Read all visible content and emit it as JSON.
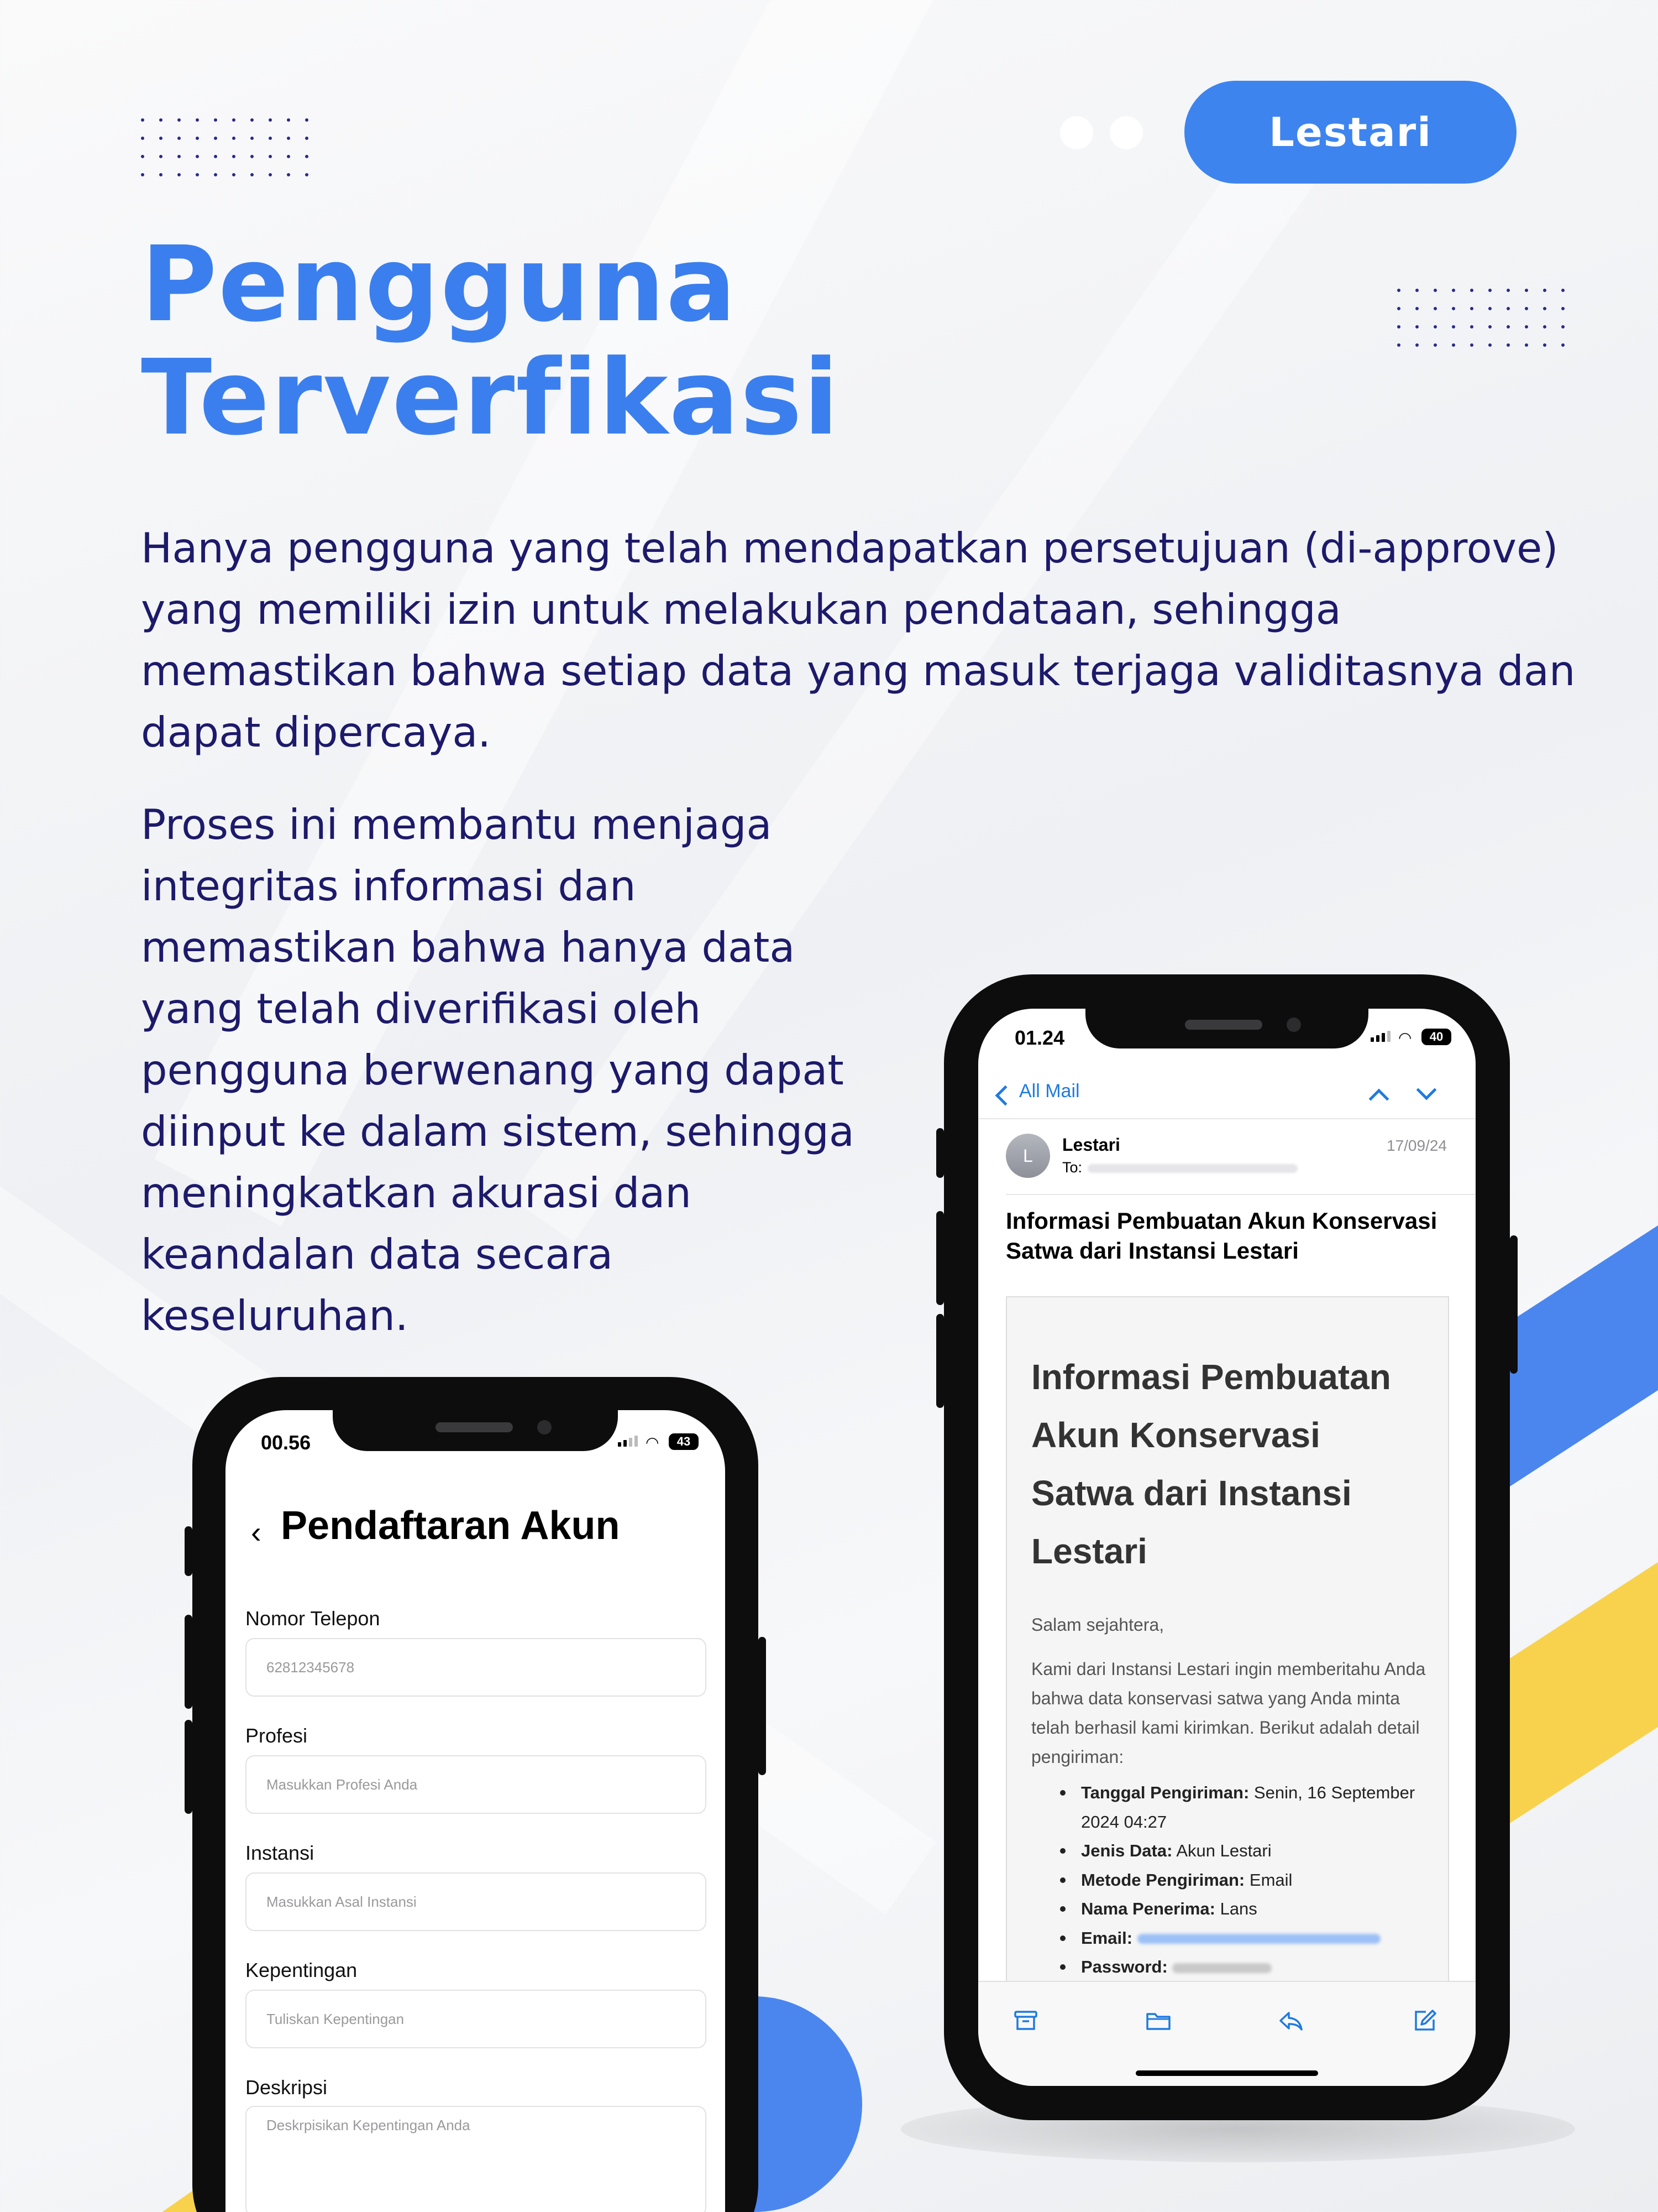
{
  "brand_pill": "Lestari",
  "headline": {
    "line1": "Pengguna",
    "line2": "Terverfikasi"
  },
  "paragraph1": "Hanya pengguna yang telah mendapatkan persetujuan (di-approve) yang memiliki izin untuk melakukan pendataan, sehingga memastikan bahwa setiap data yang masuk terjaga validitasnya dan dapat dipercaya.",
  "paragraph2": "Proses ini membantu menjaga integritas informasi dan memastikan bahwa hanya data yang telah diverifikasi oleh pengguna berwenang yang dapat diinput ke dalam sistem, sehingga meningkatkan akurasi dan keandalan data secara keseluruhan.",
  "colors": {
    "accent_blue": "#3b7fee",
    "text_navy": "#1d1a6b",
    "stripe_yellow": "#f8d24d",
    "link_blue": "#1f7ae0"
  },
  "phone_form": {
    "status_time": "00.56",
    "battery": "43",
    "back_icon": "chevron-left-icon",
    "title": "Pendaftaran Akun",
    "fields": [
      {
        "label": "Nomor Telepon",
        "placeholder": "62812345678"
      },
      {
        "label": "Profesi",
        "placeholder": "Masukkan Profesi Anda"
      },
      {
        "label": "Instansi",
        "placeholder": "Masukkan Asal Instansi"
      },
      {
        "label": "Kepentingan",
        "placeholder": "Tuliskan Kepentingan"
      },
      {
        "label": "Deskripsi",
        "placeholder": "Deskrpisikan Kepentingan Anda"
      }
    ]
  },
  "phone_mail": {
    "status_time": "01.24",
    "battery": "40",
    "back_label": "All Mail",
    "sender": "Lestari",
    "avatar_letter": "L",
    "to_label": "To:",
    "date": "17/09/24",
    "subject": "Informasi Pembuatan Akun Konservasi Satwa dari Instansi Lestari",
    "email_heading": "Informasi Pembuatan Akun Konservasi Satwa dari Instansi Lestari",
    "greeting": "Salam sejahtera,",
    "body": "Kami dari Instansi Lestari ingin memberitahu Anda bahwa data konservasi satwa yang Anda minta telah berhasil kami kirimkan. Berikut adalah detail pengiriman:",
    "details": [
      {
        "key": "Tanggal Pengiriman:",
        "value": "Senin, 16 September 2024 04:27"
      },
      {
        "key": "Jenis Data:",
        "value": "Akun Lestari"
      },
      {
        "key": "Metode Pengiriman:",
        "value": "Email"
      },
      {
        "key": "Nama Penerima:",
        "value": "Lans"
      },
      {
        "key": "Email:",
        "value": ""
      },
      {
        "key": "Password:",
        "value": ""
      }
    ],
    "toolbar_icons": [
      "archive-icon",
      "folder-icon",
      "reply-icon",
      "compose-icon"
    ]
  }
}
